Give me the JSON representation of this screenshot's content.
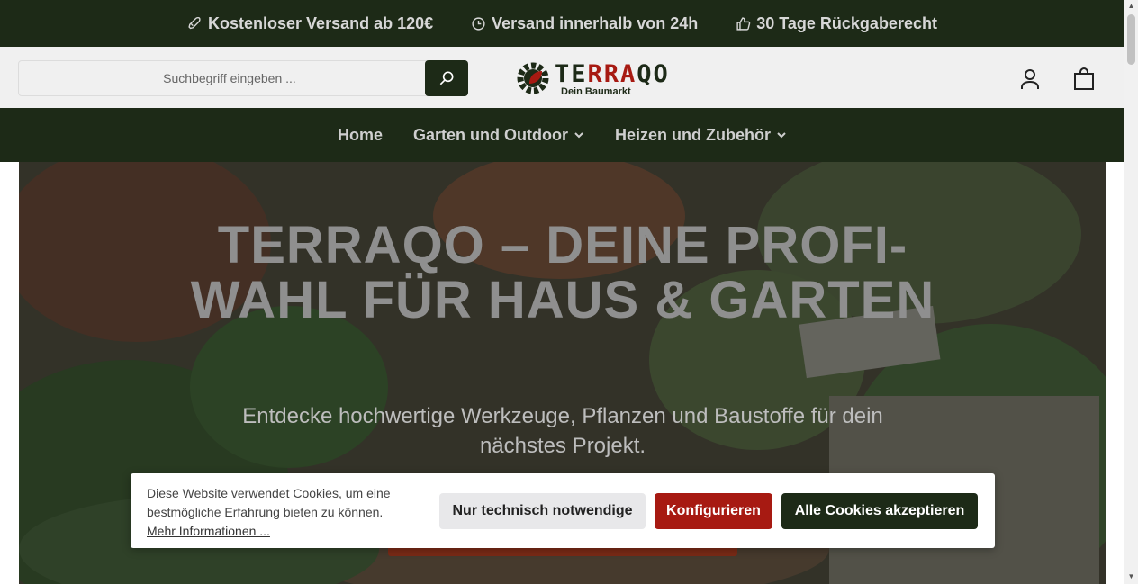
{
  "topbar": {
    "usp1": "Kostenloser Versand ab 120€",
    "usp2": "Versand innerhalb von 24h",
    "usp3": "30 Tage Rückgaberecht"
  },
  "header": {
    "search_placeholder": "Suchbegriff eingeben ...",
    "logo_brand_a": "TE",
    "logo_brand_b": "RRA",
    "logo_brand_c": "QO",
    "logo_tagline": "Dein Baumarkt"
  },
  "nav": {
    "items": [
      {
        "label": "Home"
      },
      {
        "label": "Garten und Outdoor"
      },
      {
        "label": "Heizen und Zubehör"
      }
    ]
  },
  "hero": {
    "title": "TERRAQO – DEINE PROFI-WAHL FÜR HAUS & GARTEN",
    "subtitle": "Entdecke hochwertige Werkzeuge, Pflanzen und Baustoffe für dein nächstes Projekt."
  },
  "cookie": {
    "text": "Diese Website verwendet Cookies, um eine bestmögliche Erfahrung bieten zu können.",
    "more": "Mehr Informationen ...",
    "btn_technical": "Nur technisch notwendige",
    "btn_configure": "Konfigurieren",
    "btn_accept_all": "Alle Cookies akzeptieren"
  },
  "colors": {
    "dark_green": "#1d2a17",
    "brand_red": "#a71a12"
  }
}
